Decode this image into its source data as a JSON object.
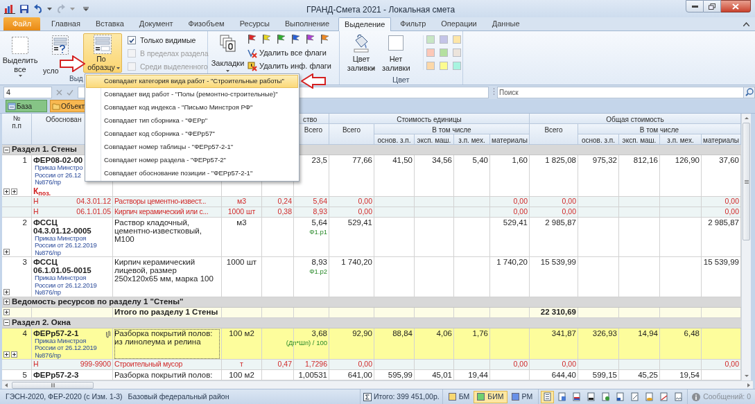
{
  "window": {
    "title": "ГРАНД-Смета 2021 - Локальная смета"
  },
  "tabs": [
    {
      "label": "Файл",
      "kind": "file",
      "selected": false
    },
    {
      "label": "Главная",
      "kind": "tab",
      "selected": false
    },
    {
      "label": "Вставка",
      "kind": "tab",
      "selected": false
    },
    {
      "label": "Документ",
      "kind": "tab",
      "selected": false
    },
    {
      "label": "Физобъем",
      "kind": "tab",
      "selected": false
    },
    {
      "label": "Ресурсы",
      "kind": "tab",
      "selected": false
    },
    {
      "label": "Выполнение",
      "kind": "tab",
      "selected": false
    },
    {
      "label": "Выделение",
      "kind": "tab",
      "selected": true
    },
    {
      "label": "Фильтр",
      "kind": "tab",
      "selected": false
    },
    {
      "label": "Операции",
      "kind": "tab",
      "selected": false
    },
    {
      "label": "Данные",
      "kind": "tab",
      "selected": false
    }
  ],
  "ribbon": {
    "select_all": {
      "label": "Выделить все"
    },
    "by_condition": {
      "label": "усло"
    },
    "by_sample": {
      "label": "По образцу",
      "selected": true
    },
    "options": [
      {
        "label": "Только видимые",
        "checked": true,
        "disabled": false
      },
      {
        "label": "В пределах раздела",
        "checked": false,
        "disabled": true
      },
      {
        "label": "Среди выделенного",
        "checked": false,
        "disabled": true
      }
    ],
    "group_label": "Выд",
    "bookmarks": {
      "label": "Закладки"
    },
    "flags": [
      {
        "color": "#e02828"
      },
      {
        "color": "#e8d820"
      },
      {
        "color": "#30b030"
      },
      {
        "color": "#2860d8"
      },
      {
        "color": "#b040d8"
      },
      {
        "color": "#f08820"
      }
    ],
    "flag_actions": [
      "Удалить все флаги",
      "Удалить инф. флаги"
    ],
    "fill": {
      "label": "Цвет заливки"
    },
    "no_fill": {
      "label": "Нет заливки"
    },
    "color_group_label": "Цвет",
    "swatches": [
      {
        "color": "#c8e6c4"
      },
      {
        "color": "#c4c4e8"
      },
      {
        "color": "#fde6a8"
      },
      {
        "color": "#fcc8b8"
      },
      {
        "color": "#b4e0a0"
      },
      {
        "color": "#ece4dc"
      },
      {
        "color": "#fcd8a8"
      },
      {
        "color": "#fcfc90"
      },
      {
        "color": "#a8f4e0"
      }
    ]
  },
  "formula_bar": {
    "value": "4"
  },
  "search": {
    "placeholder": "Поиск"
  },
  "views": [
    {
      "label": "База",
      "kind": "base"
    },
    {
      "label": "Объект",
      "kind": "object"
    }
  ],
  "menu": {
    "items": [
      {
        "label": "Совпадает категория вида работ - \"Строительные работы\"",
        "selected": true
      },
      {
        "label": "Совпадает вид работ - \"Полы (ремонтно-строительные)\"",
        "selected": false
      },
      {
        "label": "Совпадает код индекса - \"Письмо Минстроя РФ\"",
        "selected": false
      },
      {
        "label": "Совпадает тип сборника - \"ФЕРр\"",
        "selected": false
      },
      {
        "label": "Совпадает код сборника - \"ФЕРр57\"",
        "selected": false
      },
      {
        "label": "Совпадает номер таблицы - \"ФЕРр57-2-1\"",
        "selected": false
      },
      {
        "label": "Совпадает номер раздела - \"ФЕРр57-2\"",
        "selected": false
      },
      {
        "label": "Совпадает обоснование позиции - \"ФЕРр57-2-1\"",
        "selected": false
      }
    ]
  },
  "table": {
    "header": {
      "number": [
        "№",
        "п.п"
      ],
      "justification": "Обоснован",
      "quantity": "ство",
      "quantity_total": "Всего",
      "unit_cost": {
        "title": "Стоимость единицы",
        "total": "Всего",
        "including": "В том числе",
        "parts": [
          "основ. з.п.",
          "эксп. маш.",
          "з.п. мех.",
          "материалы"
        ]
      },
      "total_cost": {
        "title": "Общая стоимость",
        "total": "Всего",
        "including": "В том числе",
        "parts": [
          "основ. з.п.",
          "эксп. маш.",
          "з.п. мех.",
          "материалы"
        ]
      }
    },
    "rows": [
      {
        "kind": "section",
        "title": "Раздел 1. Стены",
        "expanded": true
      },
      {
        "kind": "position",
        "number": "1",
        "code": [
          "ФЕР08-02-00"
        ],
        "source": [
          "Приказ Минстро",
          "России от 26.12",
          "№876/пр"
        ],
        "coefficient": "К$_{поз.}$",
        "qty_total": "23,5",
        "unit_cost": {
          "total": "77,66",
          "wages": "41,50",
          "machines": "34,56",
          "machine_wages": "5,40",
          "materials": "1,60"
        },
        "total_cost": {
          "total": "1 825,08",
          "wages": "975,32",
          "machines": "812,16",
          "machine_wages": "126,90",
          "materials": "37,60"
        },
        "expand_resources": true,
        "expand_extra": true,
        "selected": false
      },
      {
        "kind": "resource",
        "type": "Н",
        "code": "04.3.01.12",
        "name": "Растворы цементно-извест...",
        "unit": "м3",
        "qty_unit": "0,24",
        "qty_total": "5,64",
        "unit_cost": {
          "total": "0,00",
          "materials": "0,00"
        },
        "total_cost": {
          "total": "0,00",
          "materials": "0,00"
        }
      },
      {
        "kind": "resource",
        "type": "Н",
        "code": "06.1.01.05",
        "name": "Кирпич керамический или с...",
        "unit": "1000 шт",
        "qty_unit": "0,38",
        "qty_total": "8,93",
        "unit_cost": {
          "total": "0,00",
          "materials": "0,00"
        },
        "total_cost": {
          "total": "0,00",
          "materials": "0,00"
        }
      },
      {
        "kind": "position",
        "number": "2",
        "code": [
          "ФССЦ",
          "04.3.01.12-0005"
        ],
        "source": [
          "Приказ Минстроя",
          "России от 26.12.2019",
          "№876/пр"
        ],
        "name": "Раствор кладочный, цементно-известковый, М100",
        "unit": "м3",
        "qty_total": "5,64",
        "qty_note": "Ф1.р1",
        "unit_cost": {
          "total": "529,41",
          "materials": "529,41"
        },
        "total_cost": {
          "total": "2 985,87",
          "materials": "2 985,87"
        },
        "expand_resources": true,
        "expand_extra": false,
        "selected": false
      },
      {
        "kind": "position",
        "number": "3",
        "code": [
          "ФССЦ",
          "06.1.01.05-0015"
        ],
        "source": [
          "Приказ Минстроя",
          "России от 26.12.2019",
          "№876/пр"
        ],
        "name": "Кирпич керамический лицевой, размер 250х120х65 мм, марка 100",
        "unit": "1000 шт",
        "qty_total": "8,93",
        "qty_note": "Ф1.р2",
        "unit_cost": {
          "total": "1 740,20",
          "materials": "1 740,20"
        },
        "total_cost": {
          "total": "15 539,99",
          "materials": "15 539,99"
        },
        "expand_resources": true,
        "expand_extra": false,
        "selected": false
      },
      {
        "kind": "section",
        "title": "Ведомость ресурсов по разделу 1 \"Стены\"",
        "expanded": false
      },
      {
        "kind": "summary",
        "label": "Итого по разделу 1 Стены",
        "total": "22 310,69"
      },
      {
        "kind": "section",
        "title": "Раздел 2. Окна",
        "expanded": true
      },
      {
        "kind": "position",
        "number": "4",
        "code": [
          "ФЕРр57-2-1"
        ],
        "source": [
          "Приказ Минстроя",
          "России от 26.12.2019",
          "№876/пр"
        ],
        "name": "Разборка покрытий полов: из линолеума и релина",
        "unit": "100 м2",
        "qty_total": "3,68",
        "qty_note": "(Дп*Шп) / 100",
        "unit_cost": {
          "total": "92,90",
          "wages": "88,84",
          "machines": "4,06",
          "machine_wages": "1,76"
        },
        "total_cost": {
          "total": "341,87",
          "wages": "326,93",
          "machines": "14,94",
          "machine_wages": "6,48"
        },
        "expand_resources": true,
        "expand_extra": true,
        "selected": true,
        "attachment": true,
        "focused": true
      },
      {
        "kind": "resource",
        "type": "Н",
        "code": "999-9900",
        "name": "Строительный мусор",
        "unit": "т",
        "qty_unit": "0,47",
        "qty_total": "1,7296",
        "unit_cost": {
          "total": "0,00",
          "materials": "0,00"
        },
        "total_cost": {
          "total": "0,00",
          "materials": "0,00"
        }
      },
      {
        "kind": "position",
        "number": "5",
        "code": [
          "ФЕРр57-2-3"
        ],
        "name": "Разборка покрытий полов:",
        "unit": "100 м2",
        "qty_total": "1,00531",
        "unit_cost": {
          "total": "641,00",
          "wages": "595,99",
          "machines": "45,01",
          "machine_wages": "19,44"
        },
        "total_cost": {
          "total": "644,40",
          "wages": "599,15",
          "machines": "45,25",
          "machine_wages": "19,54"
        },
        "selected": false,
        "cut": true
      }
    ]
  },
  "status_bar": {
    "norms": "ГЭСН-2020, ФЕР-2020 (с Изм. 1-3)",
    "region": "Базовый федеральный район",
    "total": "Итого: 399 451,00р.",
    "modes": [
      {
        "label": "БМ",
        "color": "#f8d870",
        "selected": false
      },
      {
        "label": "БИМ",
        "color": "#70d070",
        "selected": true
      },
      {
        "label": "РМ",
        "color": "#6890e8",
        "selected": false
      }
    ],
    "view_buttons": [
      {
        "selected": true
      },
      {
        "selected": false
      },
      {
        "selected": false
      },
      {
        "selected": false
      },
      {
        "selected": false
      },
      {
        "selected": false
      },
      {
        "selected": false
      },
      {
        "selected": false
      },
      {
        "selected": false
      },
      {
        "selected": false
      }
    ],
    "messages": "Сообщений: 0"
  }
}
